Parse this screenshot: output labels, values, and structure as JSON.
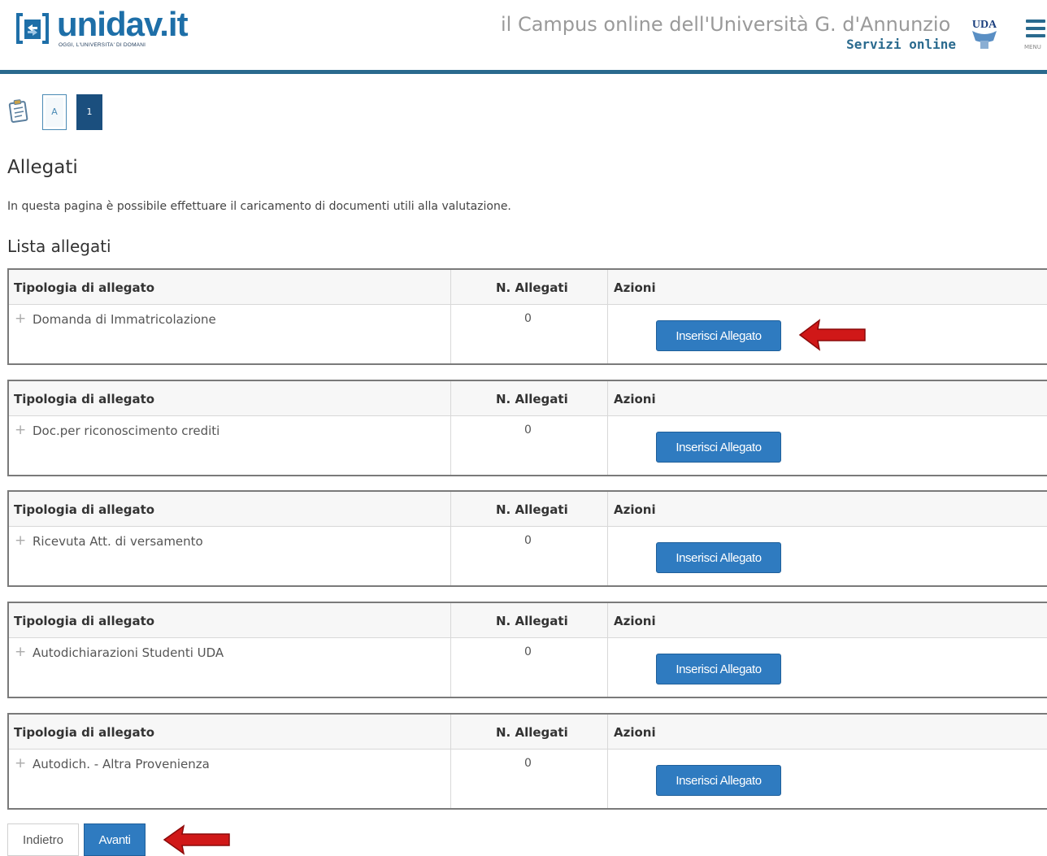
{
  "header": {
    "logo_text": "unidav.it",
    "logo_tagline": "OGGI, L'UNIVERSITA' DI DOMANI",
    "campus_title": "il Campus online dell'Università G. d'Annunzio",
    "campus_subtitle": "Servizi online",
    "uda_logo_text": "UDA",
    "menu_label": "MENU",
    "brand_color": "#1e6fa8",
    "rule_color": "#2a6a8e"
  },
  "steps": {
    "icon": "clipboard-icon",
    "items": [
      {
        "label": "A",
        "state": "inactive"
      },
      {
        "label": "1",
        "state": "active"
      }
    ]
  },
  "page": {
    "title": "Allegati",
    "description": "In questa pagina è possibile effettuare il caricamento di documenti utili alla valutazione.",
    "list_title": "Lista allegati"
  },
  "tables": {
    "headers": {
      "type": "Tipologia di allegato",
      "count": "N. Allegati",
      "actions": "Azioni"
    },
    "rows": [
      {
        "type": "Domanda di Immatricolazione",
        "count": "0",
        "action": "Inserisci Allegato"
      },
      {
        "type": "Doc.per riconoscimento crediti",
        "count": "0",
        "action": "Inserisci Allegato"
      },
      {
        "type": "Ricevuta Att. di versamento",
        "count": "0",
        "action": "Inserisci Allegato"
      },
      {
        "type": "Autodichiarazioni Studenti UDA",
        "count": "0",
        "action": "Inserisci Allegato"
      },
      {
        "type": "Autodich. - Altra Provenienza",
        "count": "0",
        "action": "Inserisci Allegato"
      }
    ]
  },
  "nav": {
    "back_label": "Indietro",
    "next_label": "Avanti"
  },
  "colors": {
    "button_primary": "#2f7bc0",
    "step_active": "#1b4f7e",
    "annotation_arrow": "#d01818"
  }
}
